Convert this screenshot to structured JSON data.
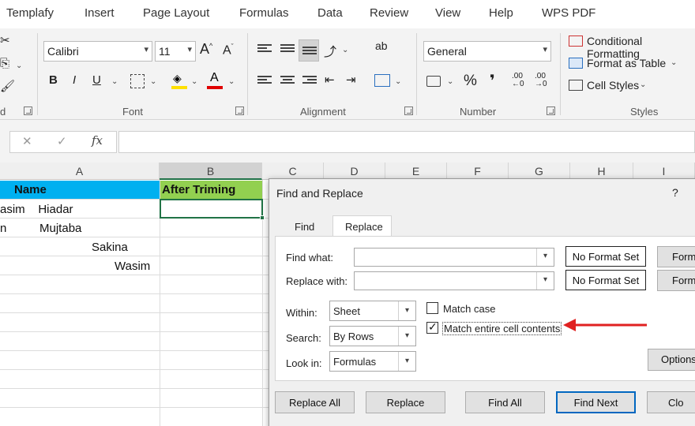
{
  "ribbon": {
    "tabs": [
      "Templafy",
      "Insert",
      "Page Layout",
      "Formulas",
      "Data",
      "Review",
      "View",
      "Help",
      "WPS PDF"
    ],
    "font": {
      "family": "Calibri",
      "size": "11",
      "group_label": "Font",
      "bold": "B",
      "italic": "I",
      "underline": "U",
      "grow": "A",
      "shrink": "A"
    },
    "alignment": {
      "group_label": "Alignment"
    },
    "number": {
      "format": "General",
      "group_label": "Number",
      "percent": "%",
      "comma": "❜"
    },
    "styles": {
      "conditional": "Conditional Formatting",
      "table": "Format as Table",
      "cell": "Cell Styles",
      "group_label": "Styles"
    },
    "clipboard": {
      "group_label_tail": "d"
    }
  },
  "formula_bar": {
    "cancel": "✕",
    "enter": "✓",
    "fx": "fx"
  },
  "sheet": {
    "columns": [
      "A",
      "B",
      "C",
      "D",
      "E",
      "F",
      "G",
      "H",
      "I"
    ],
    "header_a": "Name",
    "header_b": "After Triming",
    "rows": [
      "asim    Hiadar",
      "n          Mujtaba",
      "Sakina",
      "Wasim"
    ]
  },
  "dialog": {
    "title": "Find and Replace",
    "help": "?",
    "tabs": {
      "find": "Find",
      "replace": "Replace"
    },
    "find_what_label": "Find what:",
    "replace_with_label": "Replace with:",
    "find_what_value": "",
    "replace_with_value": "",
    "no_format_1": "No Format Set",
    "no_format_2": "No Format Set",
    "format_1": "Form",
    "format_2": "Form",
    "within_label": "Within:",
    "within_value": "Sheet",
    "search_label": "Search:",
    "search_value": "By Rows",
    "lookin_label": "Look in:",
    "lookin_value": "Formulas",
    "match_case_label": "Match case",
    "match_case_checked": false,
    "match_entire_label": "Match entire cell contents",
    "match_entire_checked": true,
    "options_button": "Options",
    "replace_all_button": "Replace All",
    "replace_button": "Replace",
    "find_all_button": "Find All",
    "find_next_button": "Find Next",
    "close_button": "Clo"
  },
  "colors": {
    "header_a_fill": "#00b0f0",
    "header_b_fill": "#92d050",
    "arrow": "#e02020",
    "accent_blue": "#0067c0"
  }
}
